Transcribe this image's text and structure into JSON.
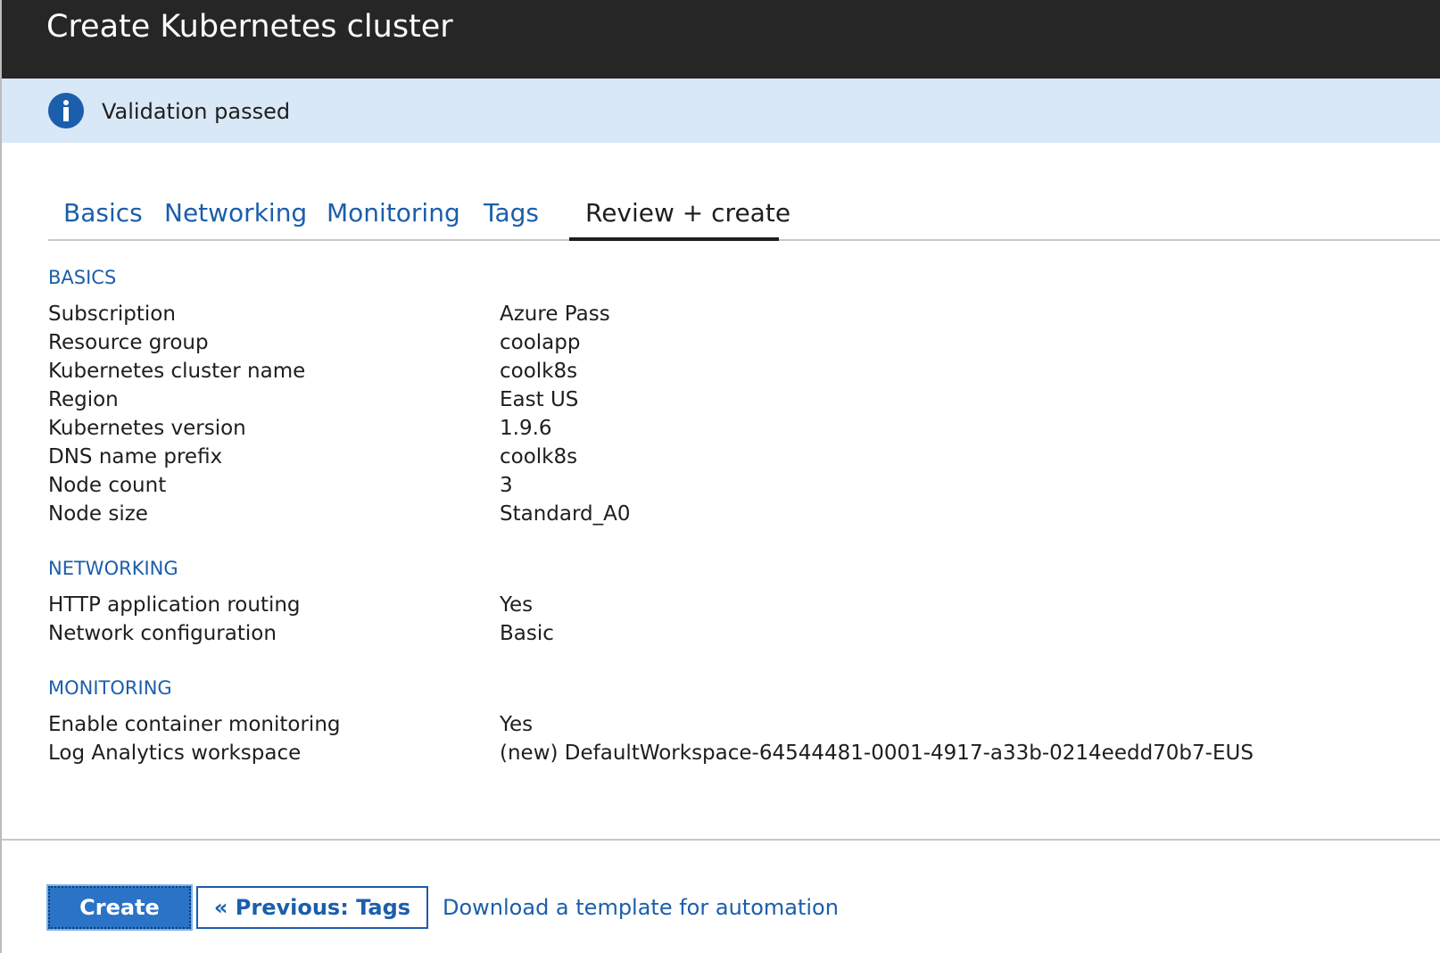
{
  "header": {
    "title": "Create Kubernetes cluster"
  },
  "banner": {
    "icon": "info-icon",
    "text": "Validation passed",
    "color": "#d8e8f6",
    "icon_color": "#1b5eab"
  },
  "tabs": [
    {
      "label": "Basics",
      "active": false
    },
    {
      "label": "Networking",
      "active": false
    },
    {
      "label": "Monitoring",
      "active": false
    },
    {
      "label": "Tags",
      "active": false
    },
    {
      "label": "Review + create",
      "active": true
    }
  ],
  "sections": {
    "basics": {
      "title": "BASICS",
      "rows": [
        {
          "label": "Subscription",
          "value": "Azure Pass"
        },
        {
          "label": "Resource group",
          "value": "coolapp"
        },
        {
          "label": "Kubernetes cluster name",
          "value": "coolk8s"
        },
        {
          "label": "Region",
          "value": "East US"
        },
        {
          "label": "Kubernetes version",
          "value": "1.9.6"
        },
        {
          "label": "DNS name prefix",
          "value": "coolk8s"
        },
        {
          "label": "Node count",
          "value": "3"
        },
        {
          "label": "Node size",
          "value": "Standard_A0"
        }
      ]
    },
    "networking": {
      "title": "NETWORKING",
      "rows": [
        {
          "label": "HTTP application routing",
          "value": "Yes"
        },
        {
          "label": "Network configuration",
          "value": "Basic"
        }
      ]
    },
    "monitoring": {
      "title": "MONITORING",
      "rows": [
        {
          "label": "Enable container monitoring",
          "value": "Yes"
        },
        {
          "label": "Log Analytics workspace",
          "value": "(new) DefaultWorkspace-64544481-0001-4917-a33b-0214eedd70b7-EUS"
        }
      ]
    }
  },
  "footer": {
    "create_label": "Create",
    "previous_label": "« Previous: Tags",
    "download_label": "Download a template for automation"
  },
  "colors": {
    "topbar": "#262626",
    "accent": "#1b5eab",
    "primary_button": "#2a73c6"
  }
}
